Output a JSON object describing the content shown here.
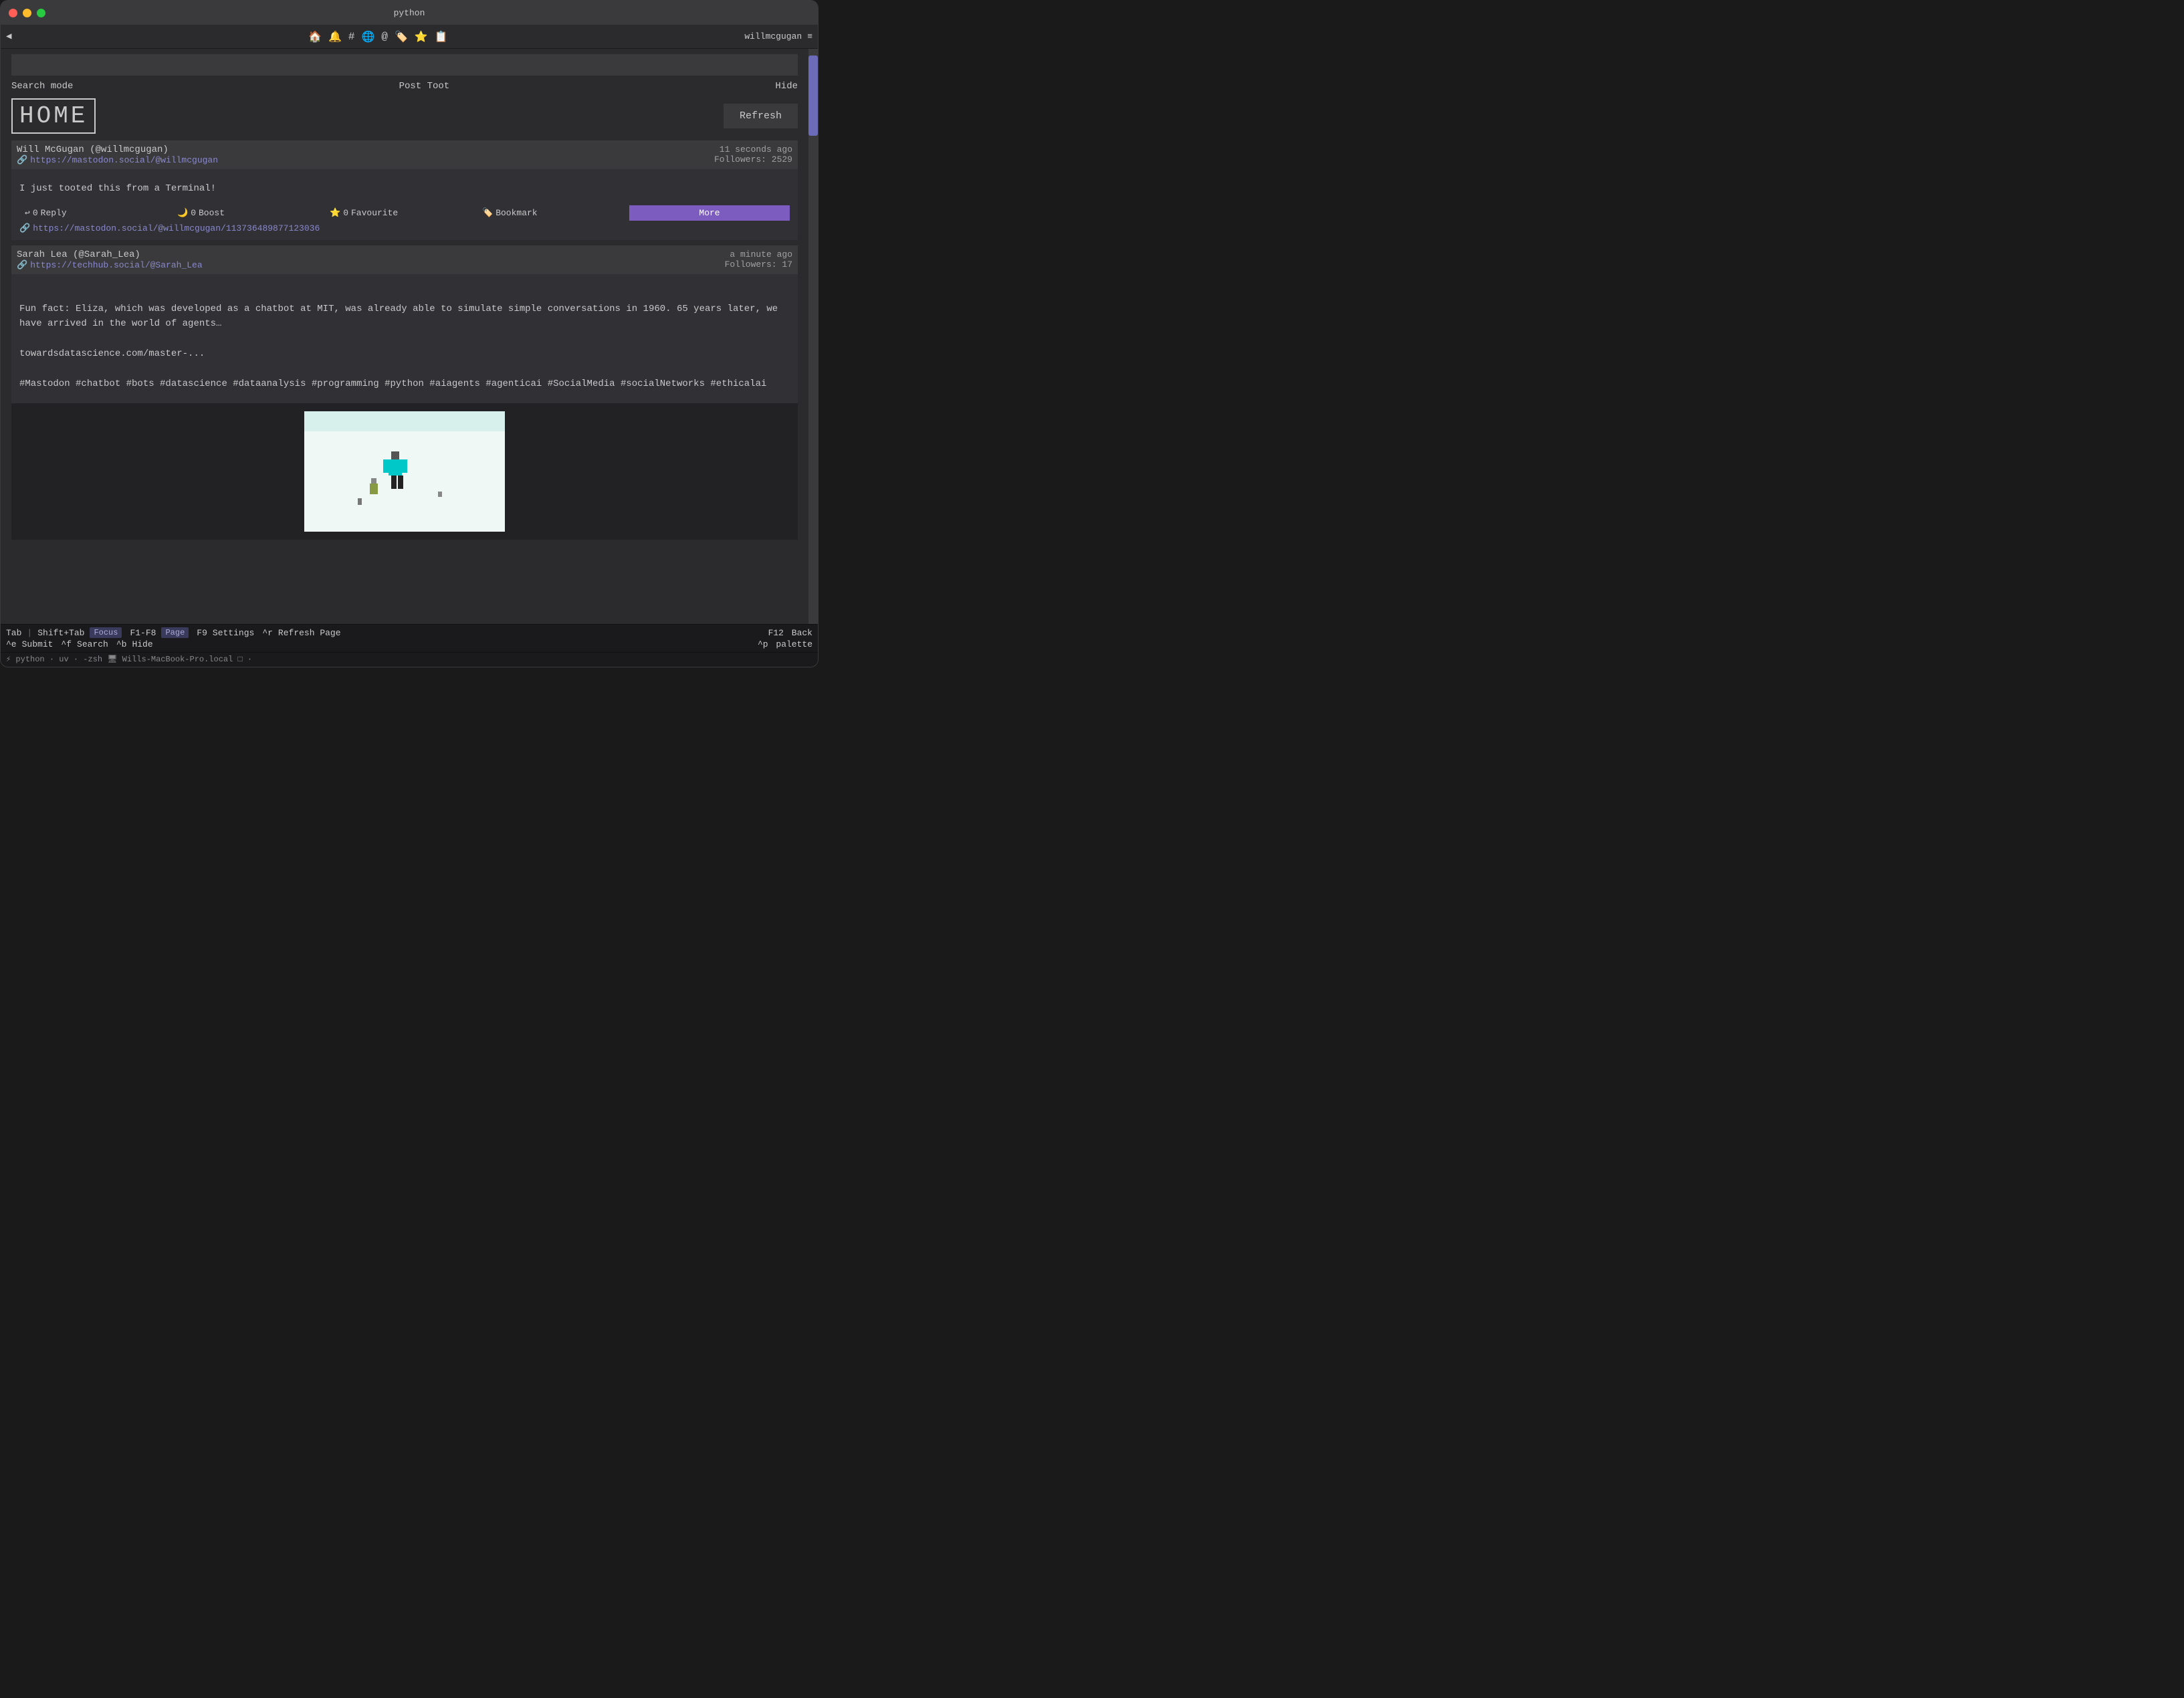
{
  "window": {
    "title": "python"
  },
  "titlebar": {
    "title": "python"
  },
  "toolbar": {
    "back_label": "◀",
    "icons": [
      "🏠",
      "🔔",
      "#",
      "🌐",
      "@",
      "🏷️",
      "⭐",
      "📋"
    ],
    "user": "willmcgugan",
    "menu": "≡"
  },
  "search_input": {
    "value": "",
    "placeholder": ""
  },
  "action_bar": {
    "search_mode": "Search mode",
    "post_toot": "Post Toot",
    "hide": "Hide"
  },
  "home": {
    "title": "HOME",
    "refresh_label": "Refresh"
  },
  "posts": [
    {
      "author": "Will McGugan (@willmcgugan)",
      "link_icon": "🔗",
      "link": "https://mastodon.social/@willmcgugan",
      "time_ago": "11 seconds ago",
      "followers_label": "Followers: 2529",
      "body": "I just tooted this from a Terminal!",
      "actions": {
        "reply_icon": "↩",
        "reply_count": "0",
        "reply_label": "Reply",
        "boost_icon": "🌙",
        "boost_count": "0",
        "boost_label": "Boost",
        "favourite_icon": "⭐",
        "favourite_count": "0",
        "favourite_label": "Favourite",
        "bookmark_icon": "🏷️",
        "bookmark_label": "Bookmark",
        "more_label": "More"
      },
      "post_link_icon": "🔗",
      "post_link": "https://mastodon.social/@willmcgugan/113736489877123036"
    },
    {
      "author": "Sarah Lea (@Sarah_Lea)",
      "link_icon": "🔗",
      "link": "https://techhub.social/@Sarah_Lea",
      "time_ago": "a minute ago",
      "followers_label": "Followers: 17",
      "body": "Fun fact: Eliza, which was developed as a chatbot at MIT, was already able to simulate simple conversations in 1960. 65 years later, we have arrived in the world of agents…\n\ntowardsdatascience.com/master-...\n\n#Mastodon #chatbot #bots #datascience #dataanalysis #programming #python #aiagents #agenticai #SocialMedia #socialNetworks #ethicalai",
      "has_preview": true,
      "preview_url": "towardsdatascience.com/master-..."
    }
  ],
  "statusbar": {
    "tab_label": "Tab",
    "shift_tab_label": "Shift+Tab",
    "focus_badge": "Focus",
    "f1f8_label": "F1-F8",
    "page_badge": "Page",
    "f9_label": "F9",
    "settings_label": "Settings",
    "ctrl_r_label": "^r",
    "refresh_page_label": "Refresh Page",
    "f12_label": "F12",
    "back_label": "Back",
    "ctrl_e_label": "^e",
    "submit_label": "Submit",
    "ctrl_f_label": "^f",
    "search_label": "Search",
    "ctrl_b_label": "^b",
    "hide_label": "Hide",
    "ctrl_p_label": "^p",
    "palette_label": "palette"
  },
  "termbar": {
    "text": "⚡ python · uv · -zsh    🖥 Wills-MacBook-Pro.local    □ ·"
  }
}
